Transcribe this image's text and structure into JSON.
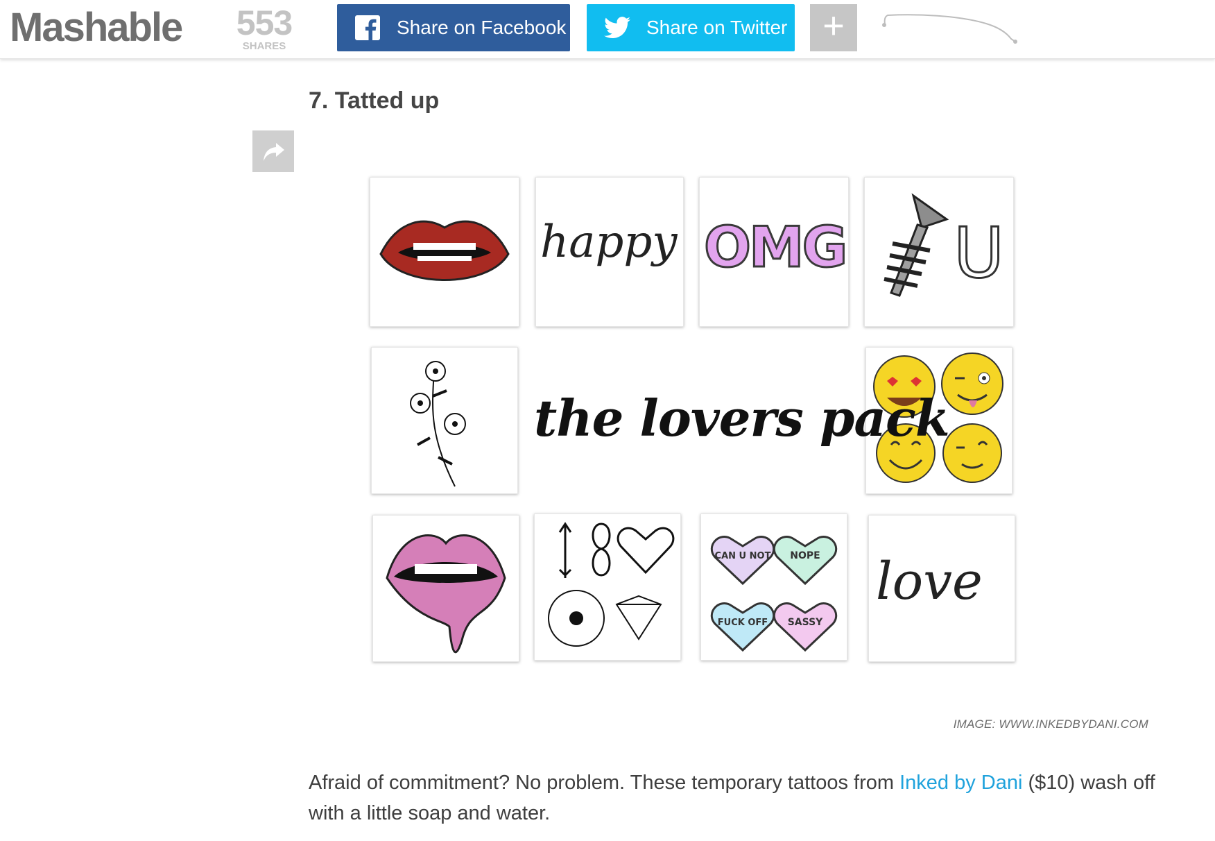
{
  "header": {
    "logo": "Mashable",
    "shares_count": "553",
    "shares_label": "SHARES",
    "facebook_label": "Share on Facebook",
    "twitter_label": "Share on Twitter",
    "more_label": "+"
  },
  "article": {
    "heading": "7. Tatted up",
    "image_title": "the lovers pack",
    "tiles": {
      "happy": "happy",
      "omg": "OMG",
      "u": "U",
      "heart1": "CAN U NOT",
      "heart2": "NOPE",
      "heart3": "FUCK OFF",
      "heart4": "SASSY",
      "love": "love"
    },
    "credit": "IMAGE: WWW.INKEDBYDANI.COM",
    "body_before": "Afraid of commitment? No problem. These temporary tattoos from ",
    "body_link": "Inked by Dani",
    "body_after": " ($10) wash off with a little soap and water."
  },
  "colors": {
    "facebook": "#2f5d9c",
    "twitter": "#11bdf0",
    "link": "#1fa2dc",
    "logo": "#6f6f6f"
  },
  "icons": [
    "facebook-icon",
    "twitter-icon",
    "plus-icon",
    "share-arrow-icon"
  ]
}
